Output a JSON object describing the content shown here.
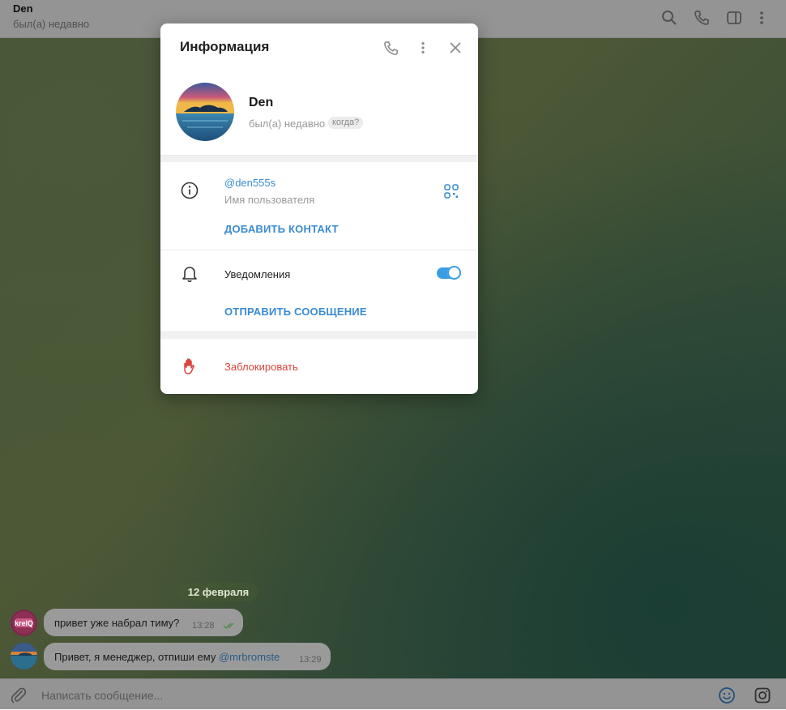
{
  "header": {
    "contact_name": "Den",
    "contact_status": "был(а) недавно",
    "icons": [
      "search-icon",
      "phone-icon",
      "sidebar-toggle-icon",
      "more-vertical-icon"
    ]
  },
  "chat": {
    "date_label": "12 февраля",
    "messages": [
      {
        "text": "привет уже набрал тиму?",
        "time": "13:28",
        "read": true
      },
      {
        "text_before": "Привет, я менеджер, отпиши ему ",
        "mention": "@mrbromste",
        "time": "13:29"
      }
    ]
  },
  "composer": {
    "placeholder": "Написать сообщение...",
    "icons": [
      "attach-icon",
      "emoji-icon",
      "camera-icon"
    ]
  },
  "info_modal": {
    "title": "Информация",
    "profile": {
      "name": "Den",
      "status": "был(а) недавно",
      "when_chip": "когда?"
    },
    "username": {
      "value": "@den555s",
      "caption": "Имя пользователя",
      "add_contact": "ДОБАВИТЬ КОНТАКТ"
    },
    "notifications": {
      "label": "Уведомления",
      "enabled": true,
      "send_message": "ОТПРАВИТЬ СООБЩЕНИЕ"
    },
    "block": {
      "label": "Заблокировать"
    }
  },
  "colors": {
    "accent": "#3a8bd1",
    "toggle_on": "#3a9ee4",
    "danger": "#d9463d"
  }
}
